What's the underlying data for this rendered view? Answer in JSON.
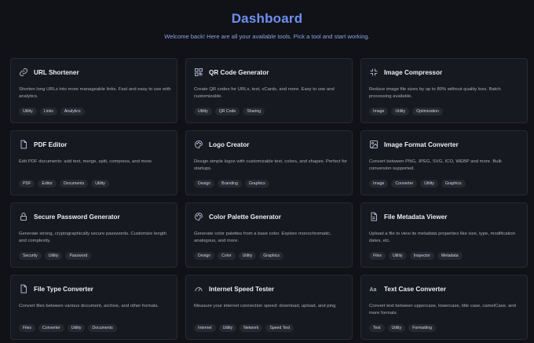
{
  "header": {
    "title": "Dashboard",
    "subtitle": "Welcome back! Here are all your available tools. Pick a tool and start working."
  },
  "colors": {
    "background": "#111217",
    "card": "#171920",
    "accent": "#6f8ff0",
    "tag_bg": "#252831"
  },
  "tools": [
    {
      "title": "URL Shortener",
      "icon": "link-icon",
      "description": "Shorten long URLs into more manageable links. Fast and easy to use with analytics.",
      "tags": [
        "Utility",
        "Links",
        "Analytics"
      ]
    },
    {
      "title": "QR Code Generator",
      "icon": "qr-code-icon",
      "description": "Create QR codes for URLs, text, vCards, and more. Easy to use and customizable.",
      "tags": [
        "Utility",
        "QR Code",
        "Sharing"
      ]
    },
    {
      "title": "Image Compressor",
      "icon": "compress-icon",
      "description": "Reduce image file sizes by up to 80% without quality loss. Batch processing available.",
      "tags": [
        "Image",
        "Utility",
        "Optimization"
      ]
    },
    {
      "title": "PDF Editor",
      "icon": "file-icon",
      "description": "Edit PDF documents: add text, merge, split, compress, and more.",
      "tags": [
        "PDF",
        "Editor",
        "Documents",
        "Utility"
      ]
    },
    {
      "title": "Logo Creator",
      "icon": "palette-icon",
      "description": "Design simple logos with customizable text, colors, and shapes. Perfect for startups.",
      "tags": [
        "Design",
        "Branding",
        "Graphics"
      ]
    },
    {
      "title": "Image Format Converter",
      "icon": "image-icon",
      "description": "Convert between PNG, JPEG, SVG, ICO, WEBP and more. Bulk conversion supported.",
      "tags": [
        "Image",
        "Converter",
        "Utility",
        "Graphics"
      ]
    },
    {
      "title": "Secure Password Generator",
      "icon": "lock-icon",
      "description": "Generate strong, cryptographically secure passwords. Customize length and complexity.",
      "tags": [
        "Security",
        "Utility",
        "Password"
      ]
    },
    {
      "title": "Color Palette Generator",
      "icon": "palette-icon",
      "description": "Generate color palettes from a base color. Explore monochromatic, analogous, and more.",
      "tags": [
        "Design",
        "Color",
        "Utility",
        "Graphics"
      ]
    },
    {
      "title": "File Metadata Viewer",
      "icon": "file-info-icon",
      "description": "Upload a file to view its metadata properties like size, type, modification dates, etc.",
      "tags": [
        "Files",
        "Utility",
        "Inspector",
        "Metadata"
      ]
    },
    {
      "title": "File Type Converter",
      "icon": "file-icon",
      "description": "Convert files between various document, archive, and other formats.",
      "tags": [
        "Files",
        "Converter",
        "Utility",
        "Documents"
      ]
    },
    {
      "title": "Internet Speed Tester",
      "icon": "speedometer-icon",
      "description": "Measure your internet connection speed: download, upload, and ping",
      "tags": [
        "Internet",
        "Utility",
        "Network",
        "Speed Test"
      ]
    },
    {
      "title": "Text Case Converter",
      "icon": "text-case-icon",
      "description": "Convert text between uppercase, lowercase, title case, camelCase, and more formats.",
      "tags": [
        "Text",
        "Utility",
        "Formatting"
      ]
    }
  ]
}
